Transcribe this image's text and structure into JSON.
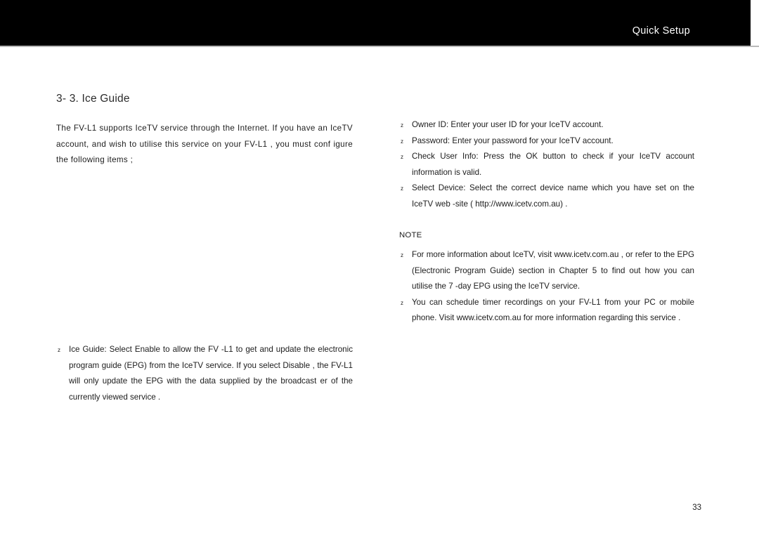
{
  "header": {
    "title": "Quick Setup"
  },
  "section": {
    "title": "3- 3.  Ice Guide"
  },
  "intro": {
    "paragraph": "The  FV-L1  supports   IceTV  service through    the  Internet.     If you have an IceTV  account,   and wish to utilise this service on your          FV-L1 , you must conf igure the following items       ;"
  },
  "left_column": {
    "bullets": [
      {
        "marker": "z",
        "text": "Ice Guide: Select  Enable  to allow the FV         -L1  to get and update the electronic program guide (EPG) from the IceTV service.              If you select  Disable , the      FV-L1  will only update the EPG with the data supplied by the broadcast    er of the currently viewed service        ."
      }
    ]
  },
  "right_column": {
    "bullets": [
      {
        "marker": "z",
        "text": "Owner ID: Enter your user ID for your IceTV account."
      },
      {
        "marker": "z",
        "text": "Password: Enter your password for your IceTV account."
      },
      {
        "marker": "z",
        "text": "Check User Info: Press the        OK  button to check if your IceTV account information is      valid."
      },
      {
        "marker": "z",
        "text": "Select Device: Select the correct device name which you have set on the IceTV web   -site (  http://www.icetv.com.au)         ."
      }
    ]
  },
  "note": {
    "label": "NOTE",
    "bullets": [
      {
        "marker": "z",
        "text": "For more information about IceTV, visit www.icetv.com.au              , or refer to the  EPG (Electronic Program Guide)  section in Chapter 5            to find out how you can utilise the 7       -day EPG using the IceTV service."
      },
      {
        "marker": "z",
        "text": "You  can  schedule  timer  recordings  on  your          FV-L1  from  your  PC  or mobile   phone.          Visit   www.icetv.com.au   for   more   information regarding this service       ."
      }
    ]
  },
  "footer": {
    "page_number": "33"
  }
}
